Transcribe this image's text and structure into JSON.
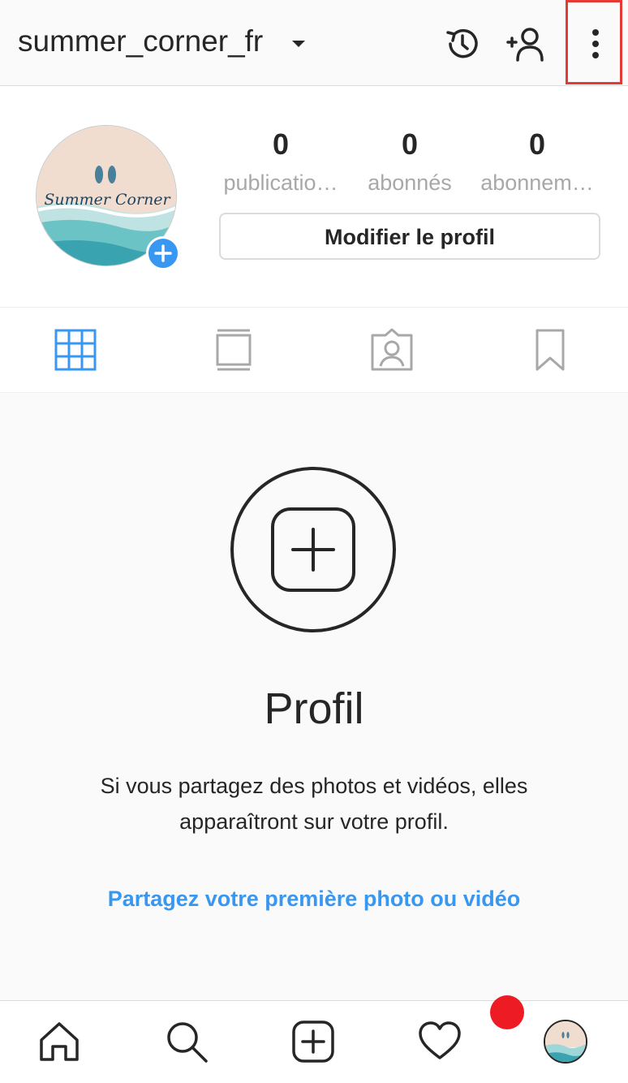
{
  "header": {
    "username": "summer_corner_fr",
    "icons": [
      "history-icon",
      "add-person-icon",
      "more-options-icon"
    ]
  },
  "profile": {
    "avatar_text": "Summer Corner",
    "stats": [
      {
        "value": "0",
        "label": "publicatio…"
      },
      {
        "value": "0",
        "label": "abonnés"
      },
      {
        "value": "0",
        "label": "abonnem…"
      }
    ],
    "edit_button": "Modifier le profil"
  },
  "tabs": [
    "grid-icon",
    "feed-icon",
    "tagged-icon",
    "saved-icon"
  ],
  "empty_state": {
    "title": "Profil",
    "description": "Si vous partagez des photos et vidéos, elles apparaîtront sur votre profil.",
    "link": "Partagez votre première photo ou vidéo"
  },
  "bottom_nav": [
    "home-icon",
    "search-icon",
    "new-post-icon",
    "activity-icon",
    "profile-avatar"
  ],
  "colors": {
    "accent": "#3897f0",
    "highlight": "#e53935",
    "notification": "#ed1c24"
  }
}
